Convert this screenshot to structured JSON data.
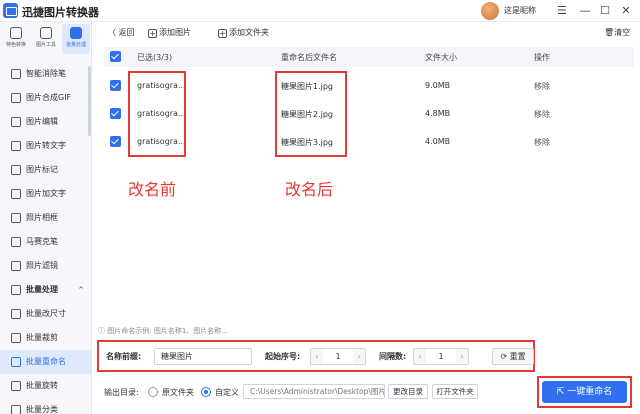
{
  "app": {
    "title": "迅捷图片转换器",
    "username": "这是昵称"
  },
  "window_controls": [
    "menu-icon",
    "minimize-icon",
    "maximize-icon",
    "close-icon"
  ],
  "modes": [
    {
      "label": "特色转换",
      "icon": "feature-icon",
      "active": false
    },
    {
      "label": "图片工具",
      "icon": "tools-icon",
      "active": false
    },
    {
      "label": "批量处理",
      "icon": "batch-icon",
      "active": true
    }
  ],
  "sidebar": {
    "items": [
      {
        "label": "智能消除笔",
        "icon": "eraser-icon"
      },
      {
        "label": "图片合成GIF",
        "icon": "gif-icon"
      },
      {
        "label": "图片编辑",
        "icon": "edit-icon"
      },
      {
        "label": "图片转文字",
        "icon": "ocr-icon"
      },
      {
        "label": "图片标记",
        "icon": "mark-icon"
      },
      {
        "label": "图片加文字",
        "icon": "text-icon"
      },
      {
        "label": "照片相框",
        "icon": "frame-icon"
      },
      {
        "label": "马赛克笔",
        "icon": "mosaic-icon"
      },
      {
        "label": "照片滤镜",
        "icon": "filter-icon"
      }
    ],
    "group": {
      "label": "批量处理",
      "caret": "^"
    },
    "batch_items": [
      {
        "label": "批量改尺寸",
        "icon": "resize-icon"
      },
      {
        "label": "批量裁剪",
        "icon": "crop-icon"
      },
      {
        "label": "批量重命名",
        "icon": "rename-icon",
        "active": true
      },
      {
        "label": "批量旋转",
        "icon": "rotate-icon"
      },
      {
        "label": "批量分类",
        "icon": "classify-icon"
      }
    ]
  },
  "toolbar": {
    "back": "〈 返回",
    "add_image": "添加图片",
    "add_folder": "添加文件夹",
    "clear": "清空"
  },
  "table": {
    "headers": {
      "selected": "已选(3/3)",
      "new_name": "重命名后文件名",
      "size": "文件大小",
      "action": "操作"
    },
    "rows": [
      {
        "original": "gratisogra...",
        "new_name": "糖果图片1.jpg",
        "size": "9.0MB",
        "action": "移除"
      },
      {
        "original": "gratisogra...",
        "new_name": "糖果图片2.jpg",
        "size": "4.8MB",
        "action": "移除"
      },
      {
        "original": "gratisogra...",
        "new_name": "糖果图片3.jpg",
        "size": "4.0MB",
        "action": "移除"
      }
    ]
  },
  "annotations": {
    "before": "改名前",
    "after": "改名后"
  },
  "settings": {
    "hint": "图片命名示例: 图片名称1、图片名称...",
    "prefix_label": "名称前缀:",
    "prefix_value": "糖果图片",
    "start_label": "起始序号:",
    "start_value": "1",
    "step_label": "间隔数:",
    "step_value": "1",
    "reset": "重置"
  },
  "output": {
    "label": "输出目录:",
    "option_original": "原文件夹",
    "option_custom": "自定义",
    "path": "C:\\Users\\Administrator\\Desktop\\图片",
    "change_dir": "更改目录",
    "open_dir": "打开文件夹",
    "selected": "custom"
  },
  "primary_action": "一键重命名",
  "colors": {
    "accent": "#2f6ff0",
    "annotation": "#e53935"
  }
}
